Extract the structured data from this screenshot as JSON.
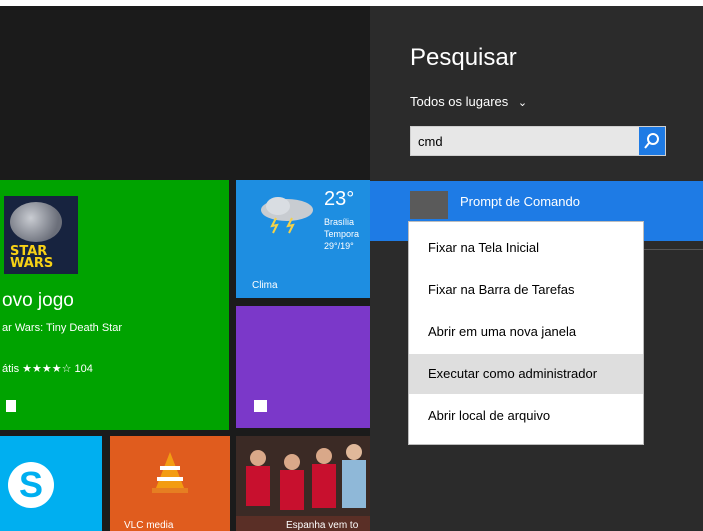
{
  "tiles": {
    "store": {
      "title": "Novo jogo",
      "title_display": "ovo jogo",
      "subtitle": "Star Wars: Tiny Death Star",
      "subtitle_display": "ar Wars: Tiny Death Star",
      "rating": "átis ★★★★☆ 104",
      "logo": "STAR WARS"
    },
    "weather": {
      "temp": "23°",
      "city": "Brasília",
      "desc": "Tempora",
      "range": "29°/19°",
      "label": "Clima"
    },
    "vlc": {
      "label": "VLC media"
    },
    "sports": {
      "label": "Espanha vem to"
    }
  },
  "search": {
    "title": "Pesquisar",
    "scope": "Todos os lugares",
    "query": "cmd"
  },
  "results": [
    {
      "name": "Prompt de Comando"
    }
  ],
  "context_menu": [
    {
      "label": "Fixar na Tela Inicial"
    },
    {
      "label": "Fixar na Barra de Tarefas"
    },
    {
      "label": "Abrir em uma nova janela"
    },
    {
      "label": "Executar como administrador",
      "highlighted": true
    },
    {
      "label": "Abrir local de arquivo"
    }
  ],
  "colors": {
    "accent": "#1e7be5",
    "store_tile": "#00a300",
    "weather_tile": "#1e8ee1",
    "calendar_tile": "#7b38c9",
    "skype_tile": "#00aff0",
    "vlc_tile": "#e05c1e"
  }
}
